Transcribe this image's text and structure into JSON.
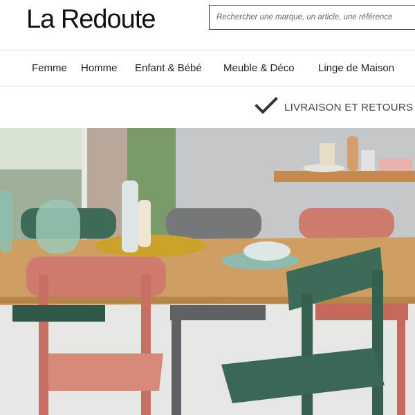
{
  "header": {
    "logo": "La Redoute",
    "search_placeholder": "Rechercher une marque, un article, une référence"
  },
  "nav": {
    "items": [
      {
        "label": "Femme"
      },
      {
        "label": "Homme"
      },
      {
        "label": "Enfant & Bébé"
      },
      {
        "label": "Meuble & Déco"
      },
      {
        "label": "Linge de Maison"
      }
    ]
  },
  "banner": {
    "icon": "check-icon",
    "text": "LIVRAISON ET RETOURS"
  },
  "hero": {
    "image": "dining-room-table-and-chairs",
    "colors": {
      "wall": "#c9cdd0",
      "table": "#cf9e63",
      "chair_green": "#3e6b58",
      "chair_pink": "#cf7a6e",
      "chair_grey": "#74787b"
    }
  }
}
